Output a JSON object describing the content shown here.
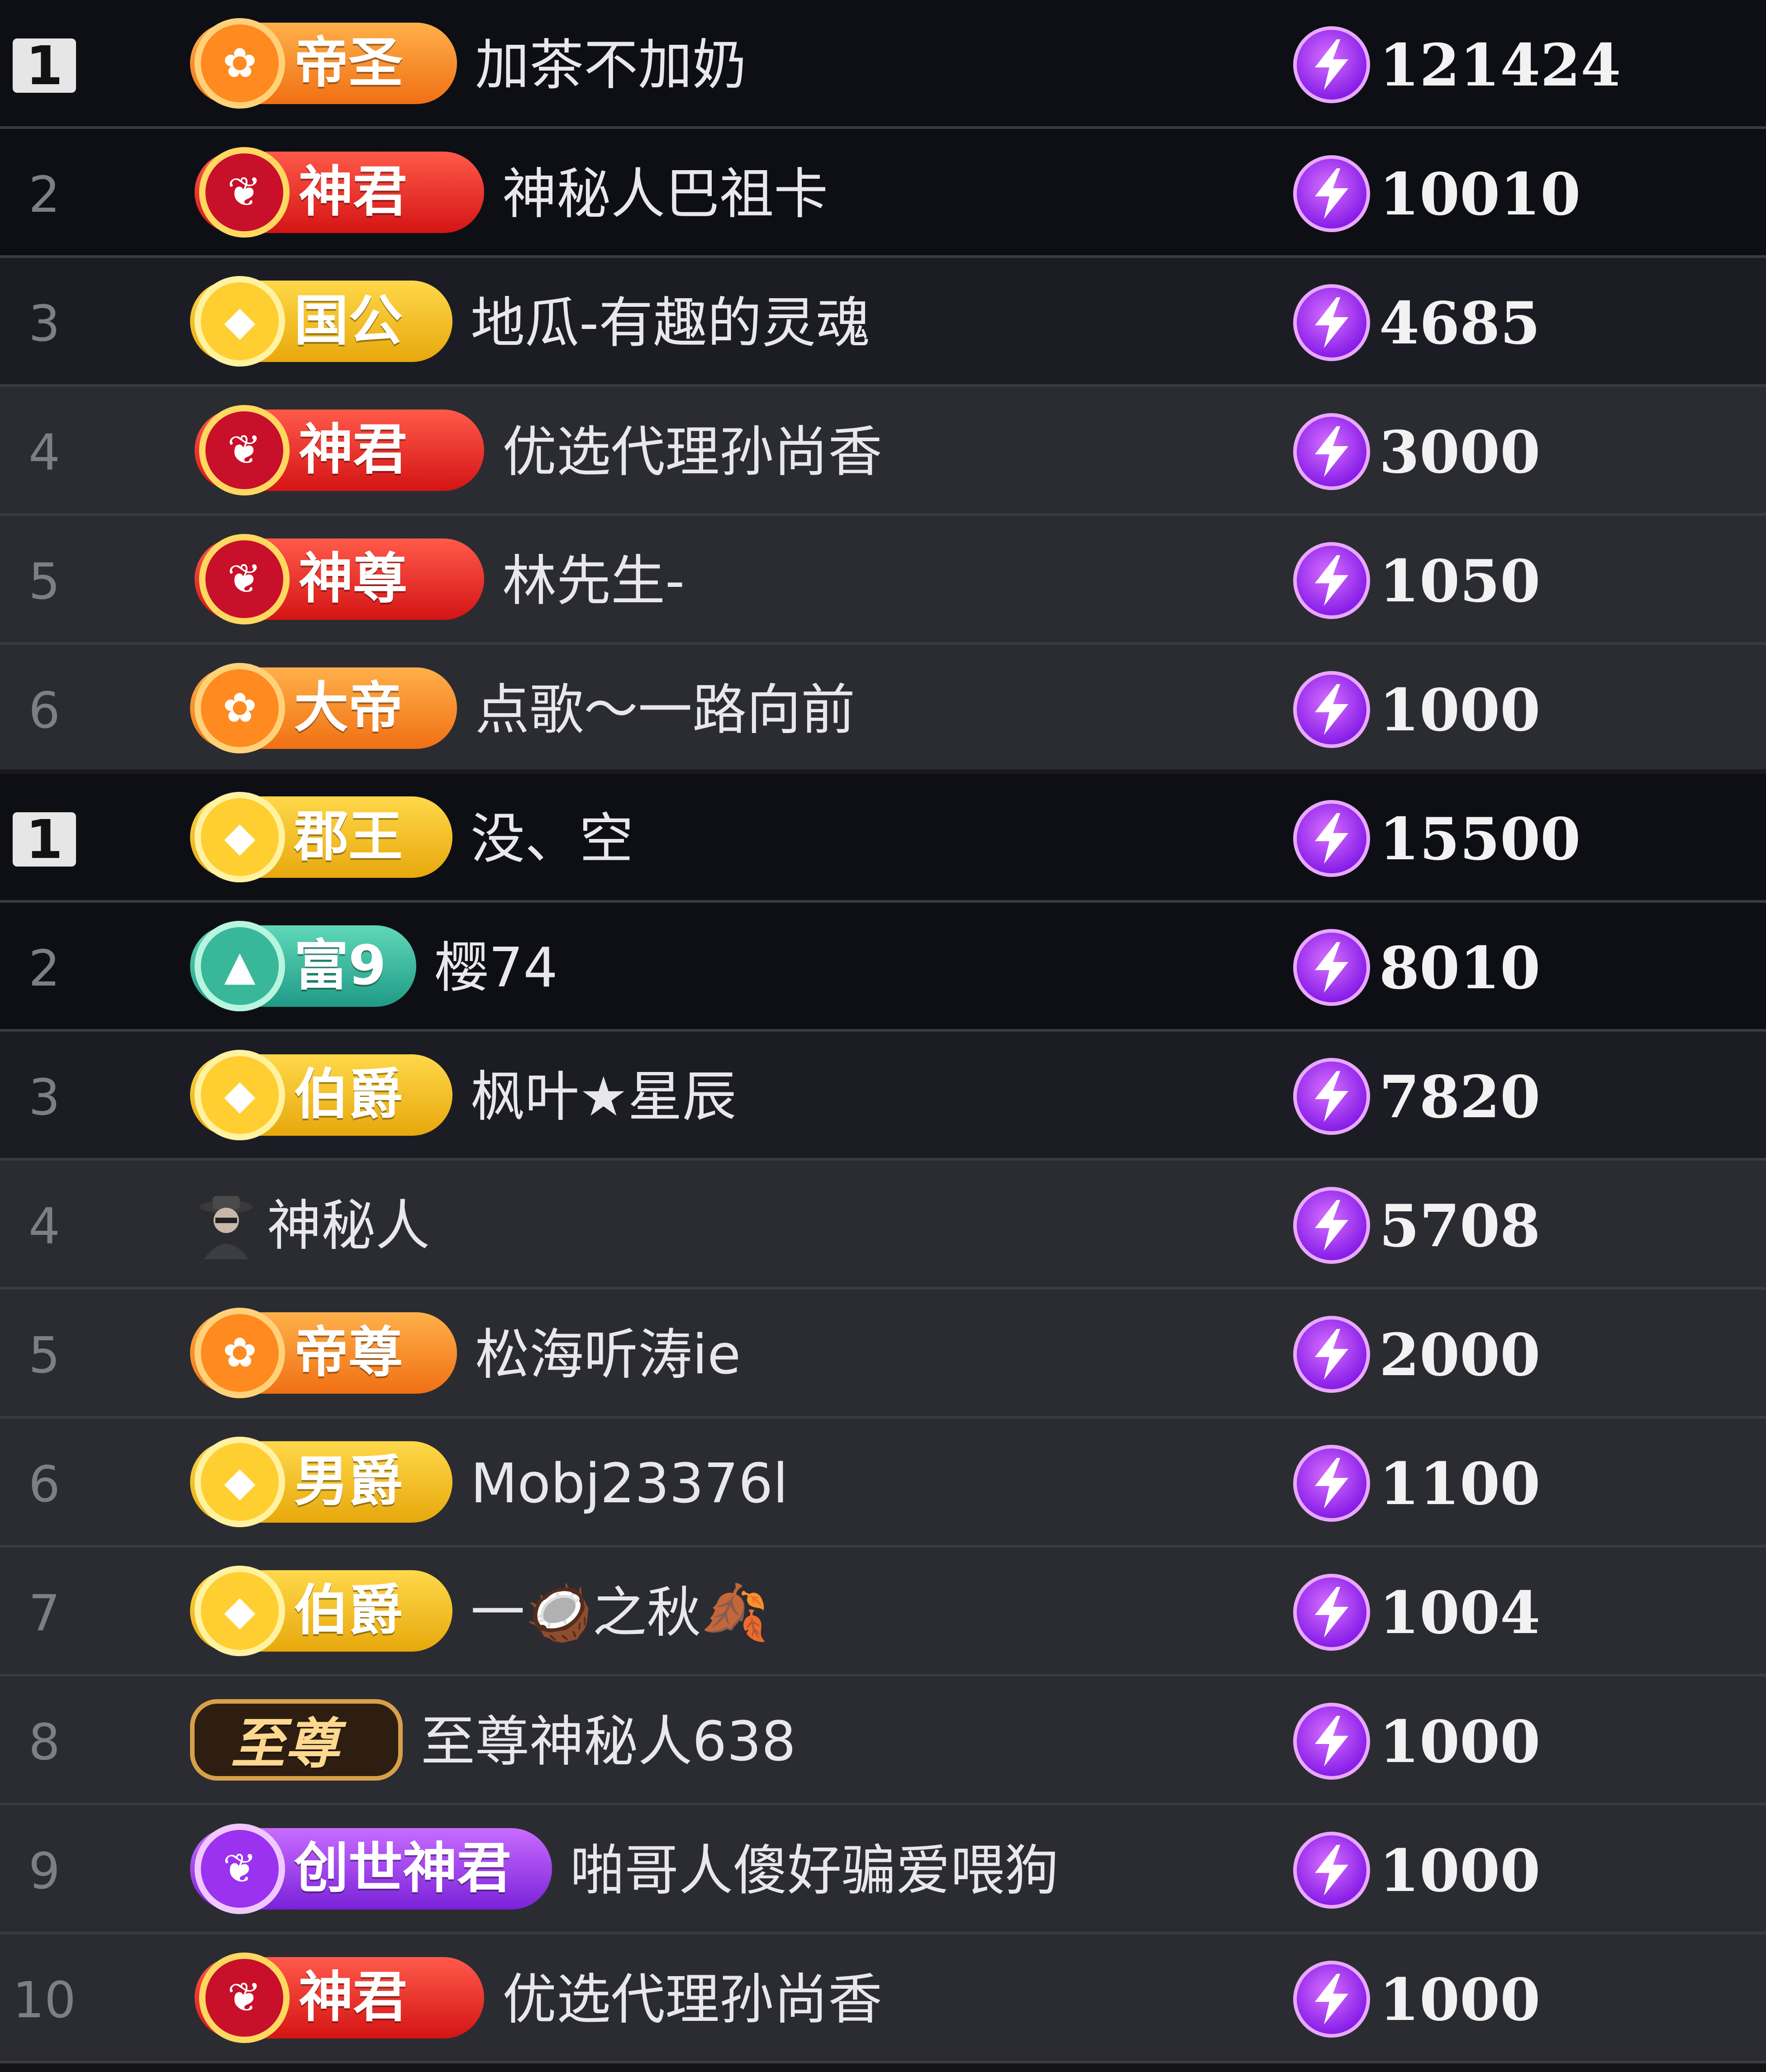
{
  "boards": [
    {
      "rows": [
        {
          "rank": "1",
          "top": true,
          "badge": "帝圣",
          "style": "orange",
          "name": "加茶不加奶",
          "score": "121424",
          "bg": "dark"
        },
        {
          "rank": "2",
          "top": false,
          "badge": "神君",
          "style": "red",
          "name": "神秘人巴祖卡",
          "score": "10010",
          "bg": "dark"
        },
        {
          "rank": "3",
          "top": false,
          "badge": "国公",
          "style": "gold",
          "name": "地瓜-有趣的灵魂",
          "score": "4685",
          "bg": "mid"
        },
        {
          "rank": "4",
          "top": false,
          "badge": "神君",
          "style": "red",
          "name": "优选代理孙尚香",
          "score": "3000",
          "bg": "light"
        },
        {
          "rank": "5",
          "top": false,
          "badge": "神尊",
          "style": "red",
          "name": "林先生-",
          "score": "1050",
          "bg": "light"
        },
        {
          "rank": "6",
          "top": false,
          "badge": "大帝",
          "style": "orange",
          "name": "点歌～一路向前",
          "score": "1000",
          "bg": "light"
        }
      ]
    },
    {
      "rows": [
        {
          "rank": "1",
          "top": true,
          "badge": "郡王",
          "style": "gold",
          "name": "没、空",
          "score": "15500",
          "bg": "dark"
        },
        {
          "rank": "2",
          "top": false,
          "badge": "富9",
          "style": "teal",
          "name": "樱74",
          "score": "8010",
          "bg": "dark"
        },
        {
          "rank": "3",
          "top": false,
          "badge": "伯爵",
          "style": "gold",
          "name": "枫叶★星辰",
          "score": "7820",
          "bg": "mid"
        },
        {
          "rank": "4",
          "top": false,
          "badge": "",
          "style": "none",
          "name": "神秘人",
          "score": "5708",
          "bg": "light"
        },
        {
          "rank": "5",
          "top": false,
          "badge": "帝尊",
          "style": "orange",
          "name": "松海听涛ie",
          "score": "2000",
          "bg": "light"
        },
        {
          "rank": "6",
          "top": false,
          "badge": "男爵",
          "style": "gold",
          "name": "Mobj23376l",
          "score": "1100",
          "bg": "light"
        },
        {
          "rank": "7",
          "top": false,
          "badge": "伯爵",
          "style": "gold",
          "name": "一🥥之秋🍂",
          "score": "1004",
          "bg": "light"
        },
        {
          "rank": "8",
          "top": false,
          "badge": "至尊",
          "style": "dark",
          "name": "至尊神秘人638",
          "score": "1000",
          "bg": "light"
        },
        {
          "rank": "9",
          "top": false,
          "badge": "创世神君",
          "style": "purple",
          "name": "啪哥人傻好骗爱喂狗",
          "score": "1000",
          "bg": "light"
        },
        {
          "rank": "10",
          "top": false,
          "badge": "神君",
          "style": "red",
          "name": "优选代理孙尚香",
          "score": "1000",
          "bg": "light"
        }
      ]
    }
  ],
  "icons": {
    "score": "lightning-bolt-icon",
    "badge": "noble-rank-emblem-icon",
    "avatar": "mystery-person-icon"
  },
  "colors": {
    "bolt": "#8a20e8",
    "score_text": "#f2f2f2",
    "rank_text": "#7e7e86"
  }
}
